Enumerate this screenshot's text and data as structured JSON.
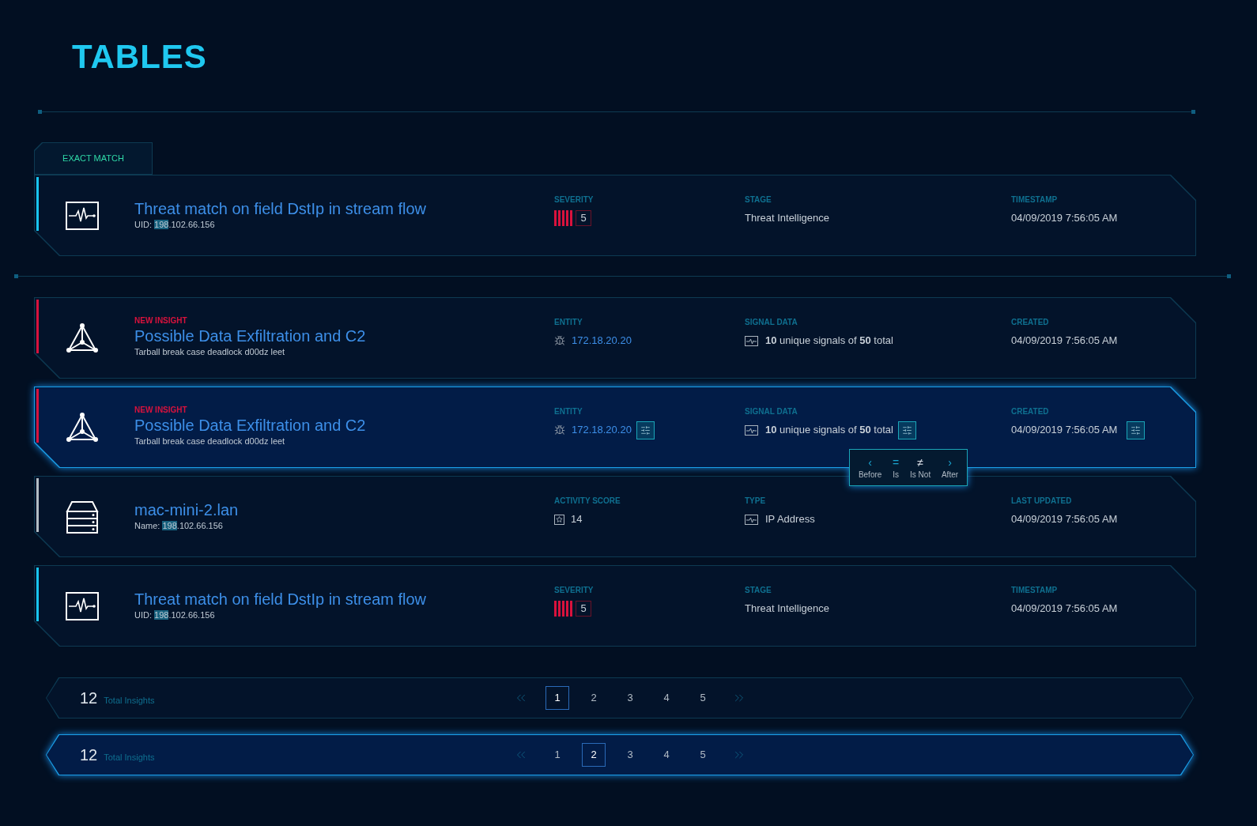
{
  "page_title": "TABLES",
  "exact_match": {
    "tab": "EXACT MATCH",
    "row": {
      "color": "#18c5f0",
      "kind": "pulse",
      "selected": false,
      "title": "Threat match on field DstIp in stream flow",
      "subtitle": {
        "prefix": "UID: ",
        "highlight": "198",
        "rest": ".102.66.156"
      },
      "fields": [
        {
          "label": "SEVERITY",
          "kind": "severity",
          "value": "5",
          "level": 1
        },
        {
          "label": "STAGE",
          "kind": "text",
          "value": "Threat Intelligence"
        },
        {
          "label": "TIMESTAMP",
          "kind": "text",
          "value": "04/09/2019 7:56:05 AM"
        }
      ]
    }
  },
  "rows": [
    {
      "color": "#d9123d",
      "kind": "network",
      "selected": false,
      "tag": "NEW INSIGHT",
      "title": "Possible Data Exfiltration and C2",
      "subtitle": {
        "prefix": "Tarball break case deadlock d00dz leet"
      },
      "fields": [
        {
          "label": "ENTITY",
          "kind": "entity",
          "value": "172.18.20.20"
        },
        {
          "label": "SIGNAL DATA",
          "kind": "signals",
          "value": "**10** unique signals of **50** total"
        },
        {
          "label": "CREATED",
          "kind": "text",
          "value": "04/09/2019 7:56:05 AM"
        }
      ]
    },
    {
      "color": "#d9123d",
      "kind": "network",
      "selected": true,
      "tag": "NEW INSIGHT",
      "title": "Possible Data Exfiltration and C2",
      "subtitle": {
        "prefix": "Tarball break case deadlock d00dz leet"
      },
      "fields": [
        {
          "label": "ENTITY",
          "kind": "entity",
          "value": "172.18.20.20"
        },
        {
          "label": "SIGNAL DATA",
          "kind": "signals",
          "value": "**10** unique signals of **50** total",
          "popover": [
            {
              "symbol": "‹",
              "label": "Before"
            },
            {
              "symbol": "=",
              "label": "Is"
            },
            {
              "symbol": "≠",
              "label": "Is Not"
            },
            {
              "symbol": "›",
              "label": "After"
            }
          ]
        },
        {
          "label": "CREATED",
          "kind": "text",
          "value": "04/09/2019 7:56:05 AM"
        }
      ]
    },
    {
      "color": "#b4bcc4",
      "kind": "server",
      "selected": false,
      "title": "mac-mini-2.lan",
      "subtitle": {
        "prefix": "Name: ",
        "highlight": "198",
        "rest": ".102.66.156"
      },
      "fields": [
        {
          "label": "ACTIVITY SCORE",
          "kind": "score",
          "value": "14"
        },
        {
          "label": "TYPE",
          "kind": "type",
          "value": "IP Address"
        },
        {
          "label": "LAST UPDATED",
          "kind": "text",
          "value": "04/09/2019 7:56:05 AM"
        }
      ]
    },
    {
      "color": "#18c5f0",
      "kind": "pulse",
      "selected": false,
      "title": "Threat match on field DstIp in stream flow",
      "subtitle": {
        "prefix": "UID: ",
        "highlight": "198",
        "rest": ".102.66.156"
      },
      "fields": [
        {
          "label": "SEVERITY",
          "kind": "severity",
          "value": "5",
          "level": 1
        },
        {
          "label": "STAGE",
          "kind": "text",
          "value": "Threat Intelligence"
        },
        {
          "label": "TIMESTAMP",
          "kind": "text",
          "value": "04/09/2019 7:56:05 AM"
        }
      ]
    }
  ],
  "paginations": [
    {
      "count": "12",
      "label": "Total Insights",
      "highlighted": false,
      "pages": [
        {
          "label": "1",
          "selected": true
        },
        {
          "label": "2",
          "selected": false
        },
        {
          "label": "3",
          "selected": false
        },
        {
          "label": "4",
          "selected": false
        },
        {
          "label": "5",
          "selected": false
        }
      ]
    },
    {
      "count": "12",
      "label": "Total Insights",
      "highlighted": true,
      "pages": [
        {
          "label": "1",
          "selected": false
        },
        {
          "label": "2",
          "selected": true
        },
        {
          "label": "3",
          "selected": false
        },
        {
          "label": "4",
          "selected": false
        },
        {
          "label": "5",
          "selected": false
        }
      ]
    }
  ]
}
